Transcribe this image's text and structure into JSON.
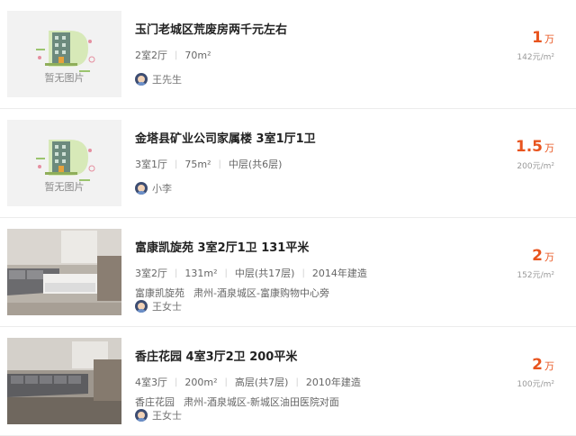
{
  "listings": [
    {
      "title": "玉门老城区荒废房两千元左右",
      "image": "no-image",
      "no_image_text": "暂无图片",
      "meta": [
        "2室2厅",
        "70m²"
      ],
      "address": [],
      "agent": "王先生",
      "price": "1",
      "price_unit": "万",
      "unit_price": "142元/m²"
    },
    {
      "title": "金塔县矿业公司家属楼 3室1厅1卫",
      "image": "no-image",
      "no_image_text": "暂无图片",
      "meta": [
        "3室1厅",
        "75m²",
        "中层(共6层)"
      ],
      "address": [],
      "agent": "小李",
      "price": "1.5",
      "price_unit": "万",
      "unit_price": "200元/m²"
    },
    {
      "title": "富康凯旋苑 3室2厅1卫 131平米",
      "image": "living-room-photo",
      "meta": [
        "3室2厅",
        "131m²",
        "中层(共17层)",
        "2014年建造"
      ],
      "address": [
        "富康凯旋苑",
        "肃州-酒泉城区-富康购物中心旁"
      ],
      "agent": "王女士",
      "price": "2",
      "price_unit": "万",
      "unit_price": "152元/m²"
    },
    {
      "title": "香庄花园 4室3厅2卫 200平米",
      "image": "living-room-photo",
      "meta": [
        "4室3厅",
        "200m²",
        "高层(共7层)",
        "2010年建造"
      ],
      "address": [
        "香庄花园",
        "肃州-酒泉城区-新城区油田医院对面"
      ],
      "agent": "王女士",
      "price": "2",
      "price_unit": "万",
      "unit_price": "100元/m²"
    }
  ]
}
